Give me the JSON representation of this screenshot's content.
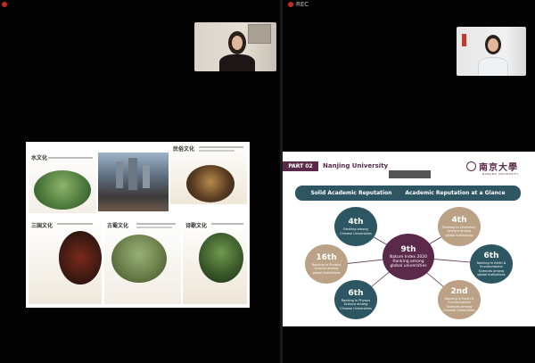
{
  "recording": {
    "label": "REC"
  },
  "slide_left": {
    "cards": [
      {
        "title": "水文化",
        "tag": ""
      },
      {
        "title": "",
        "tag": ""
      },
      {
        "title": "民俗文化",
        "tag": ""
      },
      {
        "title": "三国文化",
        "tag": ""
      },
      {
        "title": "古蜀文化",
        "tag": ""
      },
      {
        "title": "诗歌文化",
        "tag": ""
      }
    ]
  },
  "slide_right": {
    "part_tag": "PART 02",
    "part_title": "Nanjing University",
    "logo_text": "南京大學",
    "logo_sub": "NANJING UNIVERSITY",
    "banner_left": "Solid Academic Reputation",
    "banner_right": "Academic Reputation at a Glance",
    "bubbles": [
      {
        "rank": "4th",
        "text": "Ranking among Chinese Universities",
        "style": "teal"
      },
      {
        "rank": "4th",
        "text": "Ranking in Chemistry Science among global institutions",
        "style": "tan"
      },
      {
        "rank": "16th",
        "text": "Ranking in Physics Science among global institutions",
        "style": "tan"
      },
      {
        "rank": "9th",
        "text": "Nature Index 2020 Ranking among global universities",
        "style": "purple"
      },
      {
        "rank": "6th",
        "text": "Ranking in Earth & Environmental Sciences among global institutions",
        "style": "teal"
      },
      {
        "rank": "6th",
        "text": "Ranking in Physics Science among Chinese Universities",
        "style": "teal"
      },
      {
        "rank": "2nd",
        "text": "Ranking in Earth & Environmental Sciences among Chinese Universities",
        "style": "tan"
      }
    ]
  },
  "colors": {
    "accent_purple": "#5b2a4a",
    "teal": "#2c5662",
    "tan": "#bba286",
    "rec_red": "#c62828"
  }
}
